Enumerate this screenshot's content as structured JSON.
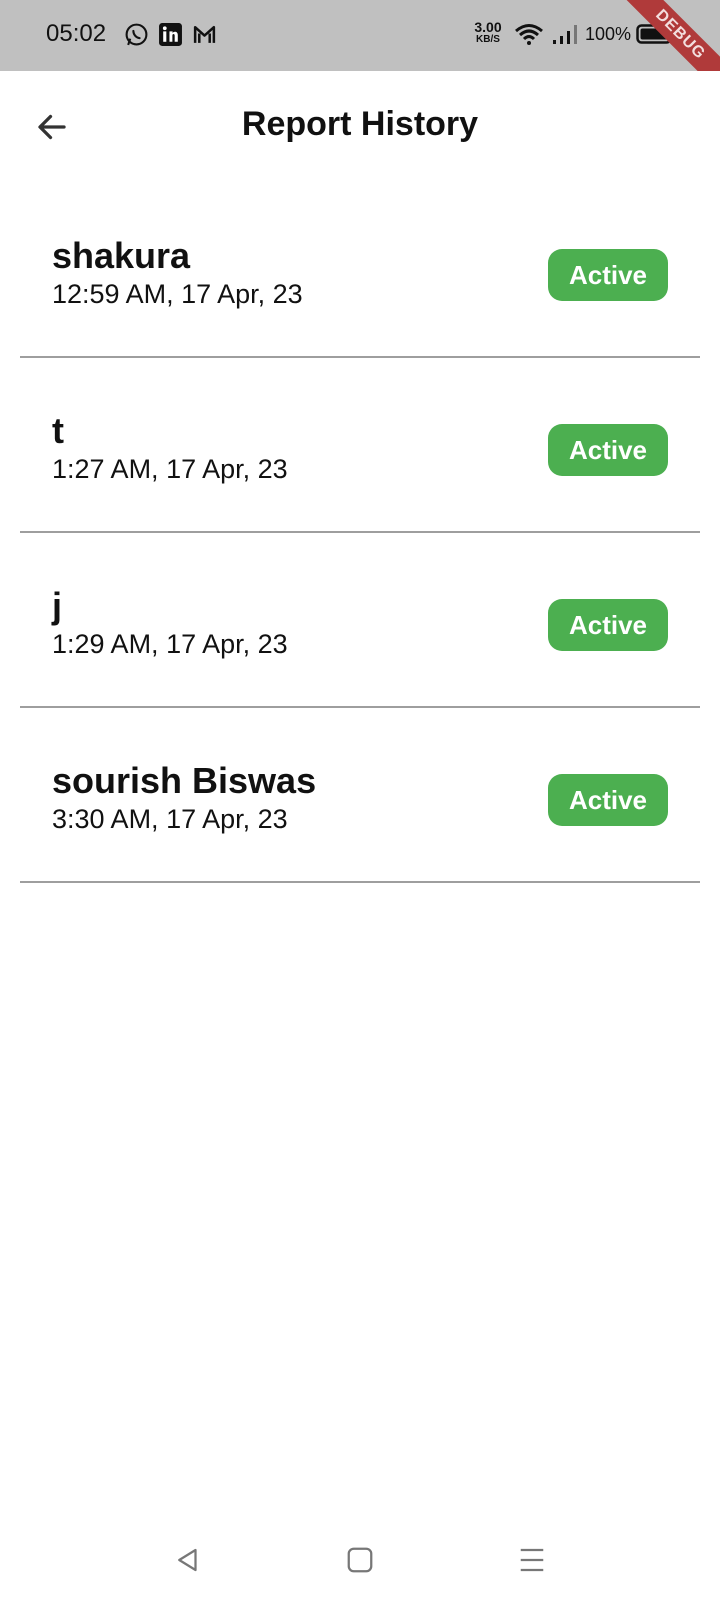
{
  "status_bar": {
    "time": "05:02",
    "app_icons": [
      "whatsapp-icon",
      "linkedin-icon",
      "gmail-icon"
    ],
    "net_speed_value": "3.00",
    "net_speed_unit": "KB/S",
    "battery_percent": "100%",
    "debug_banner": "DEBUG"
  },
  "app_bar": {
    "title": "Report History",
    "back_icon": "arrow-left-icon"
  },
  "reports": [
    {
      "name": "shakura",
      "time": "12:59 AM, 17 Apr, 23",
      "status": "Active"
    },
    {
      "name": "t",
      "time": "1:27 AM, 17 Apr, 23",
      "status": "Active"
    },
    {
      "name": "j",
      "time": "1:29 AM, 17 Apr, 23",
      "status": "Active"
    },
    {
      "name": "sourish Biswas",
      "time": "3:30 AM, 17 Apr, 23",
      "status": "Active"
    }
  ],
  "colors": {
    "status_bar_bg": "#c0c0c0",
    "active_badge": "#4caf50",
    "divider": "#9e9e9e",
    "debug_ribbon": "#b03a3a"
  },
  "nav_bar": {
    "icons": [
      "back-triangle-icon",
      "home-square-icon",
      "menu-lines-icon"
    ]
  }
}
